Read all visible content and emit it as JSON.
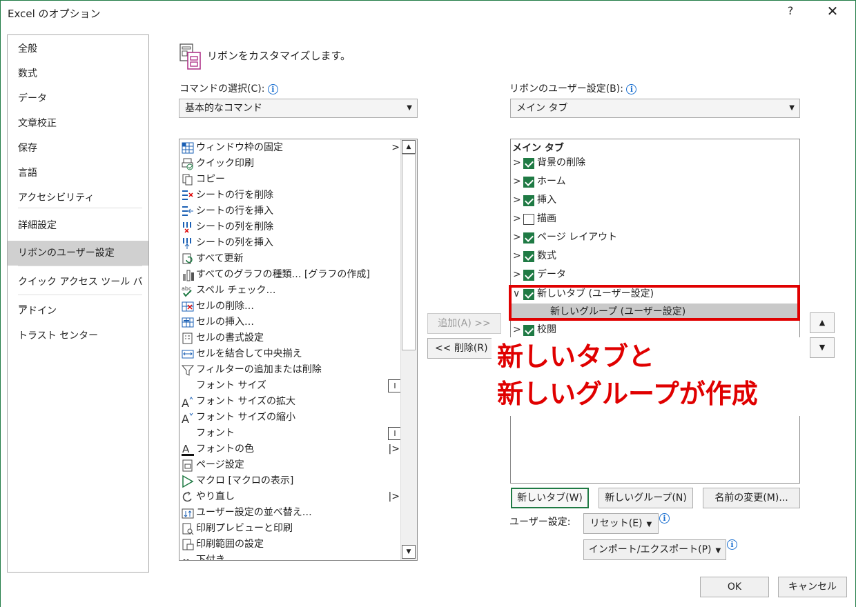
{
  "window": {
    "title": "Excel のオプション",
    "help": "?",
    "close": "✕"
  },
  "nav": {
    "items": [
      "全般",
      "数式",
      "データ",
      "文章校正",
      "保存",
      "言語",
      "アクセシビリティ",
      "詳細設定",
      "リボンのユーザー設定",
      "クイック アクセス ツール バー",
      "アドイン",
      "トラスト センター"
    ],
    "selected": "リボンのユーザー設定"
  },
  "header": {
    "title": "リボンをカスタマイズします。"
  },
  "commands": {
    "label": "コマンドの選択(C):",
    "selected": "基本的なコマンド",
    "items": [
      {
        "text": "ウィンドウ枠の固定",
        "right": ">",
        "icon": "freeze-panes-icon"
      },
      {
        "text": "クイック印刷",
        "icon": "quick-print-icon"
      },
      {
        "text": "コピー",
        "icon": "copy-icon"
      },
      {
        "text": "シートの行を削除",
        "icon": "delete-row-icon"
      },
      {
        "text": "シートの行を挿入",
        "icon": "insert-row-icon"
      },
      {
        "text": "シートの列を削除",
        "icon": "delete-column-icon"
      },
      {
        "text": "シートの列を挿入",
        "icon": "insert-column-icon"
      },
      {
        "text": "すべて更新",
        "icon": "refresh-all-icon"
      },
      {
        "text": "すべてのグラフの種類… [グラフの作成]",
        "icon": "chart-types-icon"
      },
      {
        "text": "スペル チェック…",
        "icon": "spell-check-icon"
      },
      {
        "text": "セルの削除…",
        "icon": "delete-cells-icon"
      },
      {
        "text": "セルの挿入…",
        "icon": "insert-cells-icon"
      },
      {
        "text": "セルの書式設定",
        "icon": "format-cells-icon"
      },
      {
        "text": "セルを結合して中央揃え",
        "icon": "merge-center-icon"
      },
      {
        "text": "フィルターの追加または削除",
        "icon": "filter-icon"
      },
      {
        "text": "フォント サイズ",
        "right_box": "I",
        "icon": ""
      },
      {
        "text": "フォント サイズの拡大",
        "icon": "font-size-increase-icon"
      },
      {
        "text": "フォント サイズの縮小",
        "icon": "font-size-decrease-icon"
      },
      {
        "text": "フォント",
        "right_box": "I",
        "icon": ""
      },
      {
        "text": "フォントの色",
        "right": "|>",
        "icon": "font-color-icon"
      },
      {
        "text": "ページ設定",
        "icon": "page-setup-icon"
      },
      {
        "text": "マクロ [マクロの表示]",
        "icon": "macro-icon"
      },
      {
        "text": "やり直し",
        "right": "|>",
        "icon": "redo-icon"
      },
      {
        "text": "ユーザー設定の並べ替え…",
        "icon": "custom-sort-icon"
      },
      {
        "text": "印刷プレビューと印刷",
        "icon": "print-preview-icon"
      },
      {
        "text": "印刷範囲の設定",
        "icon": "print-area-icon"
      },
      {
        "text": "下付き",
        "icon": "subscript-icon"
      }
    ]
  },
  "ribbon": {
    "label": "リボンのユーザー設定(B):",
    "selected": "メイン タブ",
    "tree_header": "メイン タブ",
    "tabs": [
      {
        "text": "背景の削除",
        "checked": true,
        "exp": ">"
      },
      {
        "text": "ホーム",
        "checked": true,
        "exp": ">"
      },
      {
        "text": "挿入",
        "checked": true,
        "exp": ">"
      },
      {
        "text": "描画",
        "checked": false,
        "exp": ">"
      },
      {
        "text": "ページ レイアウト",
        "checked": true,
        "exp": ">"
      },
      {
        "text": "数式",
        "checked": true,
        "exp": ">"
      },
      {
        "text": "データ",
        "checked": true,
        "exp": ">"
      },
      {
        "text": "新しいタブ (ユーザー設定)",
        "checked": true,
        "exp": "∨"
      },
      {
        "text": "校閲",
        "checked": true,
        "exp": ">"
      }
    ],
    "new_group": "新しいグループ (ユーザー設定)"
  },
  "buttons": {
    "add": "追加(A) >>",
    "remove": "<< 削除(R)",
    "new_tab": "新しいタブ(W)",
    "new_group": "新しいグループ(N)",
    "rename": "名前の変更(M)...",
    "reset": "リセット(E)",
    "import_export": "インポート/エクスポート(P)",
    "ok": "OK",
    "cancel": "キャンセル",
    "up": "▲",
    "down": "▼"
  },
  "customize_label": "ユーザー設定:",
  "callout": {
    "line1": "新しいタブと",
    "line2": "新しいグループが作成",
    "color": "#e00000"
  },
  "colors": {
    "accent": "#1f7a44",
    "highlight": "#e00000",
    "selected_nav": "#d0d0d0"
  }
}
